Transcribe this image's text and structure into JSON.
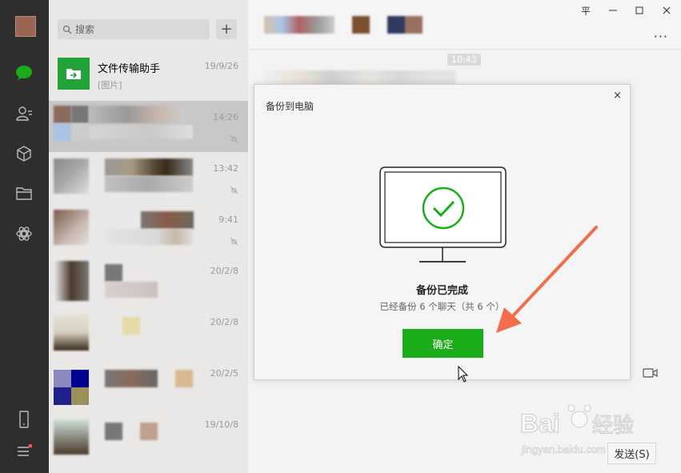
{
  "app": {
    "window_controls": [
      "pin",
      "minimize",
      "maximize",
      "close"
    ],
    "pin_glyph": "平",
    "colors": {
      "accent": "#1aad19",
      "nav_bg": "#2e2e2e",
      "list_bg": "#e9e8e7",
      "arrow": "#f26d4a"
    }
  },
  "nav": {
    "icons": [
      "chat-icon",
      "contacts-icon",
      "favorites-icon",
      "files-icon",
      "miniprogram-icon",
      "phone-icon",
      "menu-icon"
    ]
  },
  "search": {
    "placeholder": "搜索",
    "add_label": "+"
  },
  "chat_list": [
    {
      "name": "文件传输助手",
      "preview": "[图片]",
      "time": "19/9/26"
    },
    {
      "name": "",
      "preview": "",
      "time": "14:26",
      "muted": true
    },
    {
      "name": "",
      "preview": "",
      "time": "13:42",
      "muted": true
    },
    {
      "name": "",
      "preview": "",
      "time": "9:41",
      "muted": true
    },
    {
      "name": "",
      "preview": "",
      "time": "20/2/8"
    },
    {
      "name": "",
      "preview": "",
      "time": "20/2/8"
    },
    {
      "name": "",
      "preview": "",
      "time": "20/2/5"
    },
    {
      "name": "",
      "preview": "",
      "time": "19/10/8"
    }
  ],
  "chat": {
    "more_label": "···",
    "timestamp": "10:43",
    "send_label": "发送(S)"
  },
  "dialog": {
    "title": "备份到电脑",
    "close_label": "×",
    "status": "备份已完成",
    "detail": "已经备份 6 个聊天（共 6 个）",
    "confirm_label": "确定"
  },
  "watermark": {
    "brand": "Baidu 经验",
    "url": "jingyan.baidu.com"
  }
}
